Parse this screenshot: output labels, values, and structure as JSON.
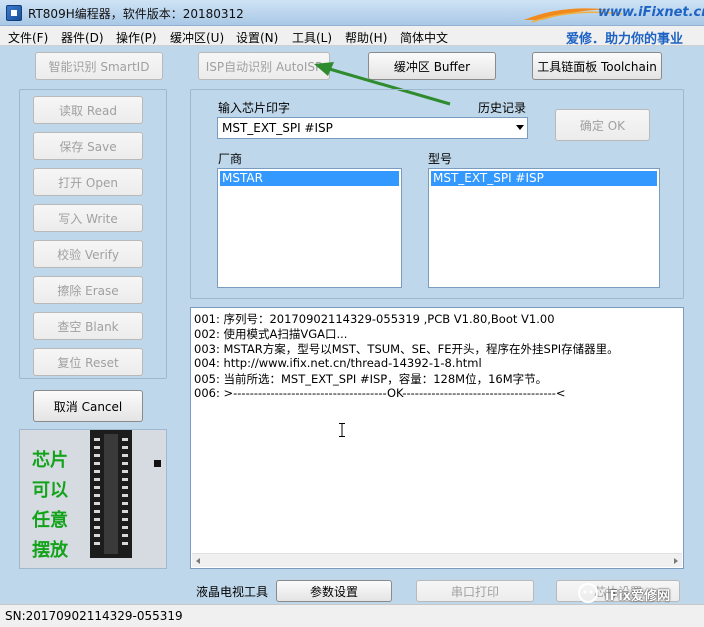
{
  "window": {
    "title": "RT809H编程器，软件版本：20180312",
    "brand": "www.iFixnet.cn"
  },
  "menu": {
    "items": [
      "文件(F)",
      "器件(D)",
      "操作(P)",
      "缓冲区(U)",
      "设置(N)",
      "工具(L)",
      "帮助(H)",
      "简体中文"
    ],
    "slogan": "爱修．助力你的事业"
  },
  "toolbar": {
    "smart_id": "智能识别 SmartID",
    "isp_auto": "ISP自动识别 AutoISP",
    "buffer": "缓冲区 Buffer",
    "toolchain": "工具链面板 Toolchain"
  },
  "left_buttons": {
    "read": "读取 Read",
    "save": "保存 Save",
    "open": "打开 Open",
    "write": "写入 Write",
    "verify": "校验 Verify",
    "erase": "擦除 Erase",
    "blank": "查空 Blank",
    "reset": "复位 Reset",
    "cancel": "取消 Cancel"
  },
  "chip_select": {
    "input_label": "输入芯片印字",
    "history_label": "历史记录",
    "value": "MST_EXT_SPI #ISP",
    "confirm": "确定 OK",
    "vendor_label": "厂商",
    "vendor_selected": "MSTAR",
    "model_label": "型号",
    "model_selected": "MST_EXT_SPI #ISP"
  },
  "log": {
    "lines": [
      "001:  序列号：20170902114329-055319  ,PCB V1.80,Boot V1.00",
      "002:  使用模式A扫描VGA口...",
      "003:  MSTAR方案，型号以MST、TSUM、SE、FE开头，程序在外挂SPI存储器里。",
      "004:  http://www.ifix.net.cn/thread-14392-1-8.html",
      "005:  当前所选：MST_EXT_SPI #ISP，容量：128M位，16M字节。",
      "006:  >-------------------------------------OK-------------------------------------<"
    ]
  },
  "chip_picture": {
    "lines": [
      "芯片",
      "可以",
      "任意",
      "摆放"
    ]
  },
  "bottom": {
    "tv_tools_label": "液晶电视工具",
    "params": "参数设置",
    "serial_print": "串口打印",
    "partial": "芯片设置"
  },
  "status": {
    "serial": "SN:20170902114329-055319"
  },
  "watermark": {
    "text": "iFix爱修网"
  }
}
